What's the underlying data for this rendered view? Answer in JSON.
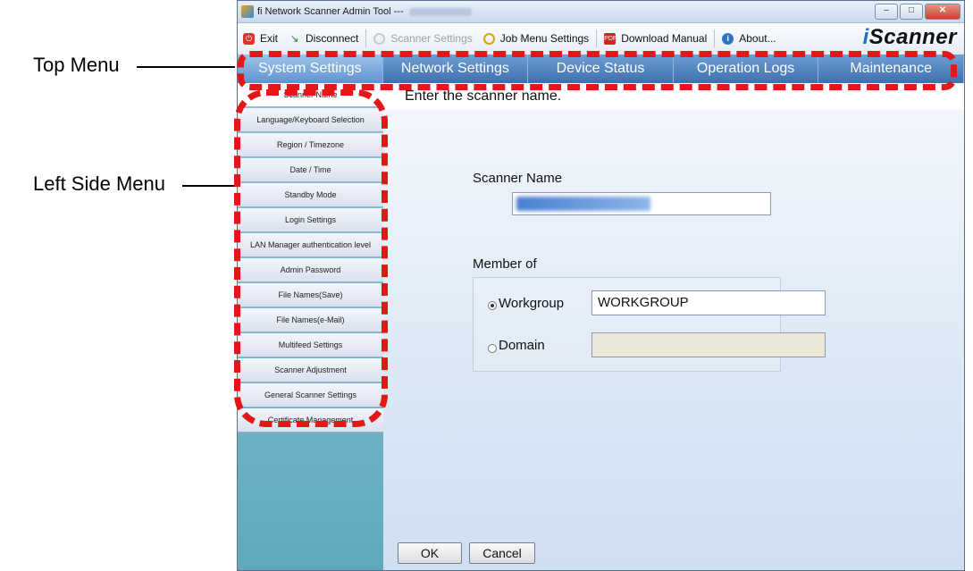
{
  "callouts": {
    "top_menu": "Top Menu",
    "left_side_menu": "Left Side Menu"
  },
  "window": {
    "title": "fi Network Scanner Admin Tool ---",
    "controls": {
      "minimize": "–",
      "maximize": "□",
      "close": "✕"
    }
  },
  "toolbar": {
    "exit": "Exit",
    "disconnect": "Disconnect",
    "scanner_settings": "Scanner Settings",
    "job_menu_settings": "Job Menu Settings",
    "download_manual": "Download Manual",
    "about": "About...",
    "brand_i": "i",
    "brand_rest": "Scanner"
  },
  "tabs": [
    {
      "label": "System Settings",
      "active": true
    },
    {
      "label": "Network Settings"
    },
    {
      "label": "Device Status"
    },
    {
      "label": "Operation Logs"
    },
    {
      "label": "Maintenance"
    }
  ],
  "sidebar": {
    "items": [
      {
        "label": "Scanner Name",
        "active": true
      },
      {
        "label": "Language/Keyboard Selection"
      },
      {
        "label": "Region / Timezone"
      },
      {
        "label": "Date / Time"
      },
      {
        "label": "Standby Mode"
      },
      {
        "label": "Login Settings"
      },
      {
        "label": "LAN Manager authentication level"
      },
      {
        "label": "Admin Password"
      },
      {
        "label": "File Names(Save)"
      },
      {
        "label": "File Names(e-Mail)"
      },
      {
        "label": "Multifeed Settings"
      },
      {
        "label": "Scanner Adjustment"
      },
      {
        "label": "General Scanner Settings"
      },
      {
        "label": "Certificate Management"
      }
    ]
  },
  "content": {
    "header": "Enter the scanner name.",
    "scanner_name_label": "Scanner Name",
    "member_of_label": "Member of",
    "workgroup_label": "Workgroup",
    "workgroup_value": "WORKGROUP",
    "domain_label": "Domain",
    "domain_value": "",
    "selected_membership": "Workgroup"
  },
  "buttons": {
    "ok": "OK",
    "cancel": "Cancel"
  },
  "colors": {
    "callout": "#e21717",
    "tab_bar": "#4f7fbf",
    "sidebar": "#6fb4c7"
  }
}
